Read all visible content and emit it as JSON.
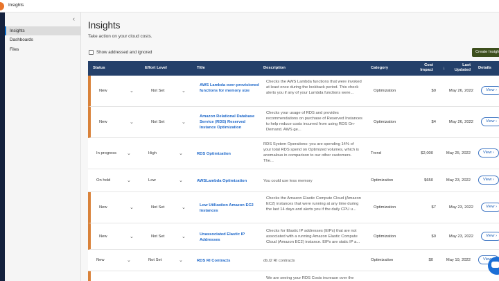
{
  "app": {
    "title": "Insights"
  },
  "sidebar": {
    "items": [
      {
        "label": "Insights",
        "active": true
      },
      {
        "label": "Dashboards",
        "active": false
      },
      {
        "label": "Files",
        "active": false
      }
    ]
  },
  "page": {
    "title": "Insights",
    "subtitle": "Take action on your cloud costs.",
    "show_addressed_label": "Show addressed and ignored",
    "create_button": "Create Insight"
  },
  "table": {
    "headers": {
      "status": "Status",
      "effort": "Effort Level",
      "title": "Title",
      "description": "Description",
      "category": "Category",
      "impact_line1": "Cost",
      "impact_line2": "Impact",
      "updated_line1": "Last",
      "updated_line2": "Updated",
      "details": "Details"
    },
    "view_label": "View",
    "rows": [
      {
        "status": "New",
        "effort": "Not Set",
        "title": "AWS Lambda over-provisioned functions for memory size",
        "description": "Checks the AWS Lambda functions that were invoked at least once during the lookback period. This check alerts you if any of your Lambda functions were...",
        "category": "Optimization",
        "impact": "$0",
        "updated": "May 26, 2022"
      },
      {
        "status": "New",
        "effort": "Not Set",
        "title": "Amazon Relational Database Service (RDS) Reserved Instance Optimization",
        "description": "Checks your usage of RDS and provides recommendations on purchase of Reserved Instances to help reduce costs incurred from using RDS On-Demand. AWS ge...",
        "category": "Optimization",
        "impact": "$4",
        "updated": "May 26, 2022"
      },
      {
        "status": "In progress",
        "effort": "High",
        "title": "RDS Optimization",
        "description": "RDS System Operations: you are spending 14% of your total RDS spend on Optimized volumes, which is anomalous in comparison to our other customers. The...",
        "category": "Trend",
        "impact": "$2,000",
        "updated": "May 25, 2022"
      },
      {
        "status": "On hold",
        "effort": "Low",
        "title": "AWSLambda Optimization",
        "description": "You could use less memory",
        "category": "Optimization",
        "impact": "$650",
        "updated": "May 23, 2022"
      },
      {
        "status": "New",
        "effort": "Not Set",
        "title": "Low Utilization Amazon EC2 Instances",
        "description": "Checks the Amazon Elastic Compute Cloud (Amazon EC2) instances that were running at any time during the last 14 days and alerts you if the daily CPU u...",
        "category": "Optimization",
        "impact": "$7",
        "updated": "May 23, 2022"
      },
      {
        "status": "New",
        "effort": "Not Set",
        "title": "Unassociated Elastic IP Addresses",
        "description": "Checks for Elastic IP addresses (EIPs) that are not associated with a running Amazon Elastic Compute Cloud (Amazon EC2) instance. EIPs are static IP a...",
        "category": "Optimization",
        "impact": "$0",
        "updated": "May 23, 2022"
      },
      {
        "status": "New",
        "effort": "Not Set",
        "title": "RDS RI Contracts",
        "description": "db.t2 RI contracts",
        "category": "Optimization",
        "impact": "$0",
        "updated": "May 19, 2022"
      },
      {
        "status": "",
        "effort": "",
        "title": "",
        "description": "We are seeing your RDS Costs increase over the",
        "category": "",
        "impact": "",
        "updated": ""
      }
    ]
  }
}
